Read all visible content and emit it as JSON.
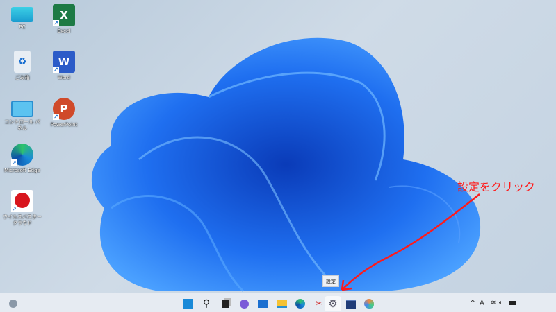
{
  "desktop_icons": [
    {
      "label": "PC",
      "icon": "pc-icon"
    },
    {
      "label": "Excel",
      "icon": "excel-icon"
    },
    {
      "label": "ごみ箱",
      "icon": "recycle-bin-icon"
    },
    {
      "label": "Word",
      "icon": "word-icon"
    },
    {
      "label": "コントロール パネル",
      "icon": "control-panel-icon"
    },
    {
      "label": "PowerPoint",
      "icon": "powerpoint-icon"
    },
    {
      "label": "Microsoft Edge",
      "icon": "edge-icon"
    },
    {
      "label": "ウイルスバスター クラウド",
      "icon": "virus-buster-icon"
    }
  ],
  "tooltip": "設定",
  "annotation": {
    "text": "設定をクリック",
    "color": "#ff1a1a"
  },
  "taskbar": {
    "items": [
      "start",
      "search",
      "task-view",
      "chat",
      "mail",
      "file-explorer",
      "edge",
      "snipping-tool",
      "settings",
      "store",
      "paint"
    ],
    "active": "settings",
    "tray": {
      "chevron": "^",
      "ime": "A"
    }
  },
  "colors": {
    "taskbar": "#e6ebf2",
    "accent": "#1a6fd0"
  }
}
